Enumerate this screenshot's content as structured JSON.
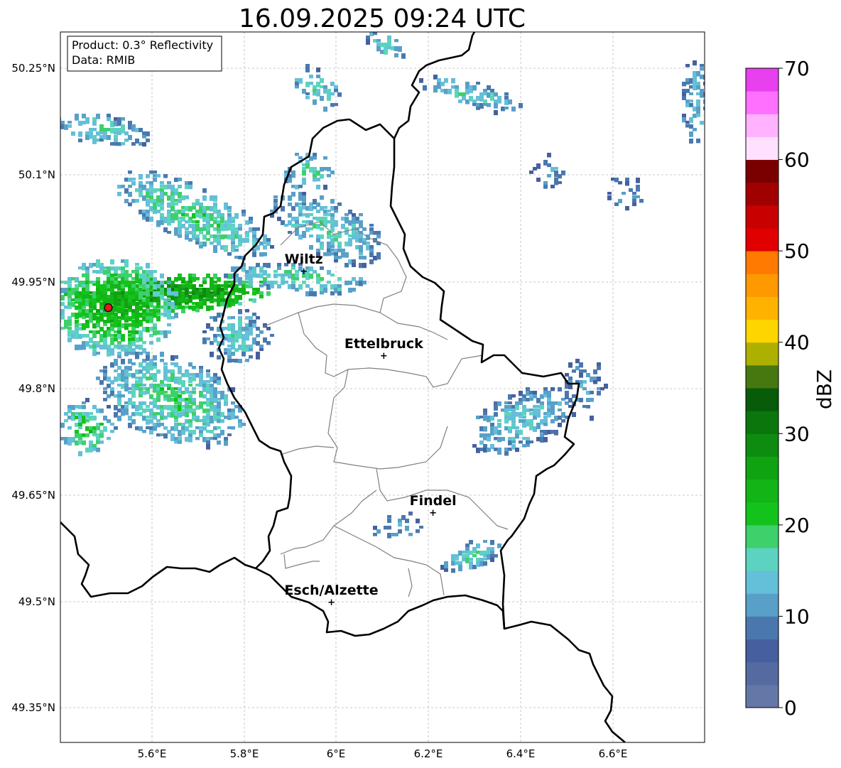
{
  "title": "16.09.2025 09:24 UTC",
  "info_box": {
    "product": "Product: 0.3° Reflectivity",
    "data_source": "Data: RMIB"
  },
  "x_ticks": [
    "5.6°E",
    "5.8°E",
    "6°E",
    "6.2°E",
    "6.4°E",
    "6.6°E"
  ],
  "y_ticks": [
    "50.25°N",
    "50.1°N",
    "49.95°N",
    "49.8°N",
    "49.65°N",
    "49.5°N",
    "49.35°N"
  ],
  "cities": [
    {
      "name": "Wiltz",
      "lon": 5.93,
      "lat": 49.966
    },
    {
      "name": "Ettelbruck",
      "lon": 6.104,
      "lat": 49.847
    },
    {
      "name": "Findel",
      "lon": 6.211,
      "lat": 49.626
    },
    {
      "name": "Esch/Alzette",
      "lon": 5.99,
      "lat": 49.5
    }
  ],
  "radar_site": {
    "lon": 5.505,
    "lat": 49.914,
    "color": "#e31a1c"
  },
  "colorbar": {
    "label": "dBZ",
    "ticks": [
      "0",
      "10",
      "20",
      "30",
      "40",
      "50",
      "60",
      "70"
    ],
    "min": 0,
    "max": 70,
    "step": 2.5,
    "colors": [
      "#6577a6",
      "#556aa0",
      "#465f9e",
      "#4a78ae",
      "#58a0c8",
      "#64bfd8",
      "#5cd3c0",
      "#3dd06b",
      "#13c31c",
      "#12b515",
      "#0fa312",
      "#0d8c0f",
      "#0b760c",
      "#075b09",
      "#477810",
      "#aeb000",
      "#ffd500",
      "#ffb300",
      "#ff9900",
      "#ff7a00",
      "#e00000",
      "#c80000",
      "#a00000",
      "#7a0000",
      "#ffe0ff",
      "#ffb3ff",
      "#ff70ff",
      "#e83fef"
    ]
  }
}
